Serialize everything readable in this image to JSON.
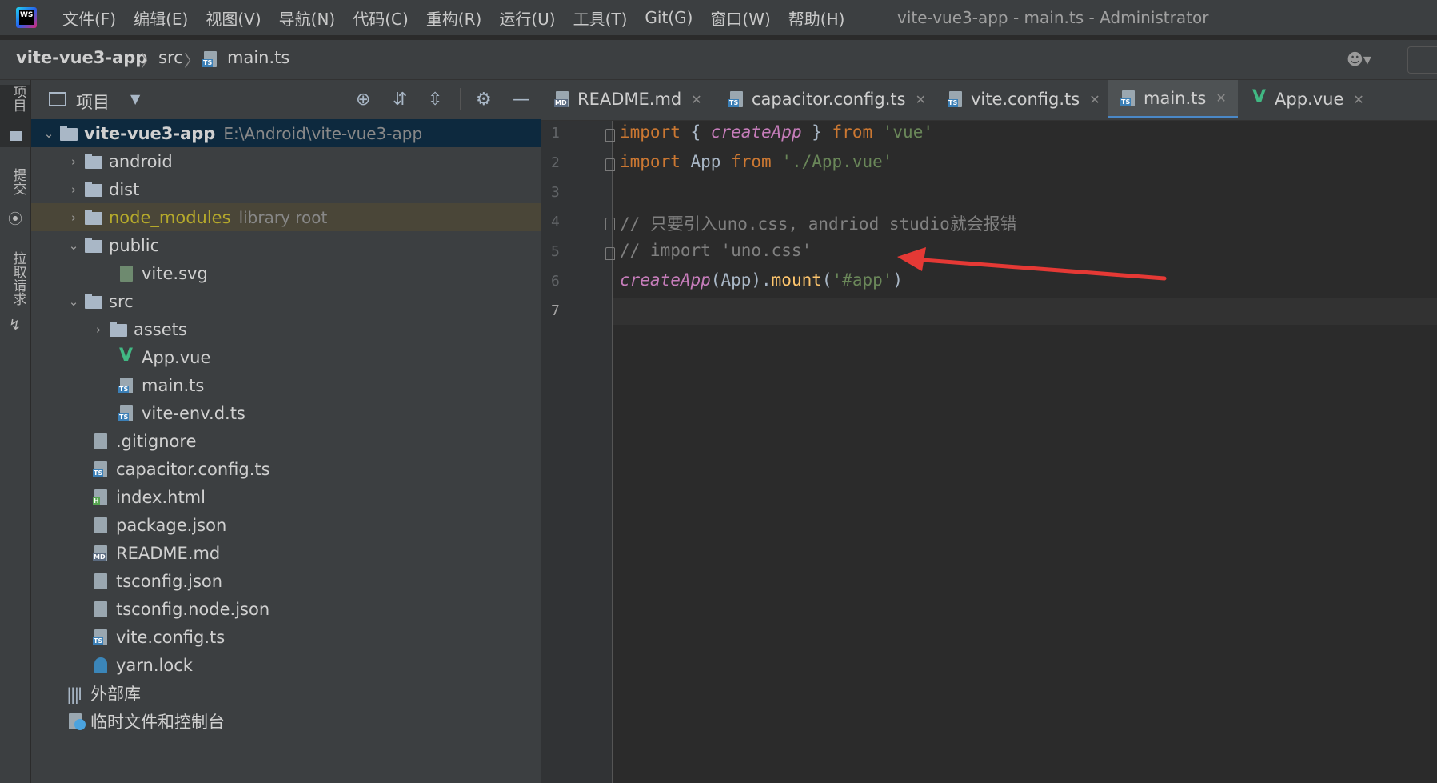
{
  "menu": {
    "logo_text": "WS",
    "items": [
      "文件(F)",
      "编辑(E)",
      "视图(V)",
      "导航(N)",
      "代码(C)",
      "重构(R)",
      "运行(U)",
      "工具(T)",
      "Git(G)",
      "窗口(W)",
      "帮助(H)"
    ],
    "window_title": "vite-vue3-app - main.ts - Administrator"
  },
  "breadcrumb": [
    "vite-vue3-app",
    "src",
    "main.ts"
  ],
  "tool_strip": {
    "project": "项目",
    "commit": "提交",
    "pull_requests": "拉取请求"
  },
  "project_panel": {
    "title": "项目",
    "tree": [
      {
        "label": "vite-vue3-app",
        "hint": "E:\\Android\\vite-vue3-app",
        "type": "folder",
        "level": 0,
        "expanded": true
      },
      {
        "label": "android",
        "type": "folder",
        "level": 1,
        "expanded": false
      },
      {
        "label": "dist",
        "type": "folder",
        "level": 1,
        "expanded": false
      },
      {
        "label": "node_modules",
        "hint": "library root",
        "type": "folder",
        "level": 1,
        "expanded": false
      },
      {
        "label": "public",
        "type": "folder",
        "level": 1,
        "expanded": true
      },
      {
        "label": "vite.svg",
        "type": "file",
        "level": 2
      },
      {
        "label": "src",
        "type": "folder",
        "level": 1,
        "expanded": true
      },
      {
        "label": "assets",
        "type": "folder",
        "level": 2,
        "expanded": false
      },
      {
        "label": "App.vue",
        "type": "vue",
        "level": 2
      },
      {
        "label": "main.ts",
        "type": "ts",
        "level": 2
      },
      {
        "label": "vite-env.d.ts",
        "type": "ts",
        "level": 2
      },
      {
        "label": ".gitignore",
        "type": "file",
        "level": 1
      },
      {
        "label": "capacitor.config.ts",
        "type": "ts",
        "level": 1
      },
      {
        "label": "index.html",
        "type": "html",
        "level": 1
      },
      {
        "label": "package.json",
        "type": "json",
        "level": 1
      },
      {
        "label": "README.md",
        "type": "md",
        "level": 1
      },
      {
        "label": "tsconfig.json",
        "type": "json",
        "level": 1
      },
      {
        "label": "tsconfig.node.json",
        "type": "json",
        "level": 1
      },
      {
        "label": "vite.config.ts",
        "type": "ts",
        "level": 1
      },
      {
        "label": "yarn.lock",
        "type": "file",
        "level": 1
      },
      {
        "label": "外部库",
        "type": "lib",
        "level": 0
      },
      {
        "label": "临时文件和控制台",
        "type": "scratch",
        "level": 0
      }
    ]
  },
  "editor": {
    "tabs": [
      {
        "label": "README.md",
        "icon": "md",
        "active": false
      },
      {
        "label": "capacitor.config.ts",
        "icon": "ts",
        "active": false
      },
      {
        "label": "vite.config.ts",
        "icon": "ts",
        "active": false
      },
      {
        "label": "main.ts",
        "icon": "ts",
        "active": true
      },
      {
        "label": "App.vue",
        "icon": "vue",
        "active": false
      }
    ],
    "line_numbers": [
      "1",
      "2",
      "3",
      "4",
      "5",
      "6",
      "7"
    ],
    "lines": {
      "l1": {
        "kw1": "import",
        "p1": " { ",
        "fn": "createApp",
        "p2": " } ",
        "kw2": "from",
        "sp": " ",
        "str": "'vue'"
      },
      "l2": {
        "kw1": "import",
        "p1": " App ",
        "kw2": "from",
        "sp": " ",
        "str": "'./App.vue'"
      },
      "l4": {
        "cm": "// 只要引入uno.css, andriod studio就会报错"
      },
      "l5": {
        "cm": "// import 'uno.css'"
      },
      "l6": {
        "fn": "createApp",
        "p1": "(App).",
        "mth": "mount",
        "p2": "(",
        "str": "'#app'",
        "p3": ")"
      }
    }
  },
  "colors": {
    "annotation_arrow": "#e53935",
    "active_tab_underline": "#4a88c7",
    "node_modules_highlight": "#4a4638"
  }
}
